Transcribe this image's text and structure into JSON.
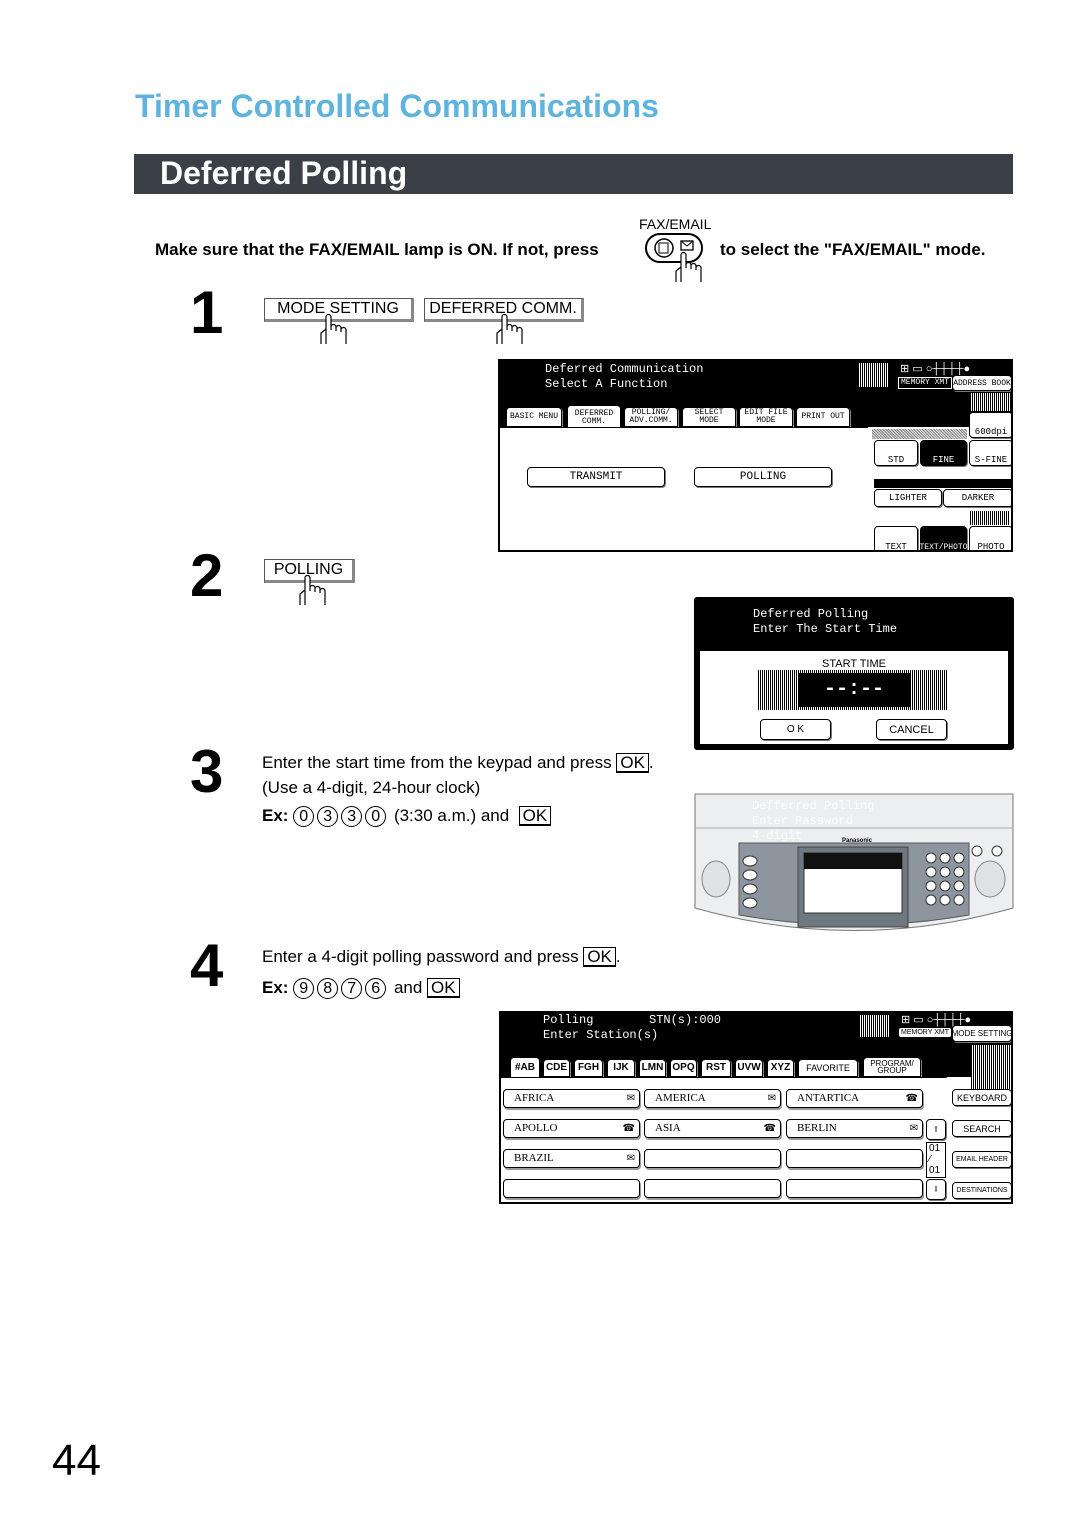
{
  "header": {
    "section_title": "Timer Controlled Communications",
    "page_title": "Deferred Polling"
  },
  "intro": {
    "text_before": "Make sure that the FAX/EMAIL lamp is ON.  If not, press",
    "button_label": "FAX/EMAIL",
    "text_after": "to select the \"FAX/EMAIL\" mode."
  },
  "steps": [
    {
      "number": "1",
      "buttons": [
        "MODE SETTING",
        "DEFERRED COMM."
      ]
    },
    {
      "number": "2",
      "buttons": [
        "POLLING"
      ]
    },
    {
      "number": "3",
      "line1": "Enter the start time from the keypad and press",
      "ok": "OK",
      "period": ".",
      "line2": "(Use a 4-digit, 24-hour clock)",
      "ex_label": "Ex:",
      "ex_digits": [
        "0",
        "3",
        "3",
        "0"
      ],
      "ex_note": "(3:30 a.m.) and",
      "ex_ok": "OK"
    },
    {
      "number": "4",
      "line1": "Enter a 4-digit polling password and press",
      "ok": "OK",
      "period": ".",
      "ex_label": "Ex:",
      "ex_digits": [
        "9",
        "8",
        "7",
        "6"
      ],
      "ex_and": "and",
      "ex_ok": "OK"
    }
  ],
  "screen1": {
    "line1": "Deferred Communication",
    "line2": "Select A Function",
    "tabs": [
      "BASIC MENU",
      "DEFERRED COMM.",
      "POLLING/ ADV.COMM.",
      "SELECT MODE",
      "EDIT FILE MODE",
      "PRINT OUT"
    ],
    "active_tab": "DEFERRED COMM.",
    "buttons": [
      "TRANSMIT",
      "POLLING"
    ],
    "memory_xmt": "MEMORY XMT",
    "address_book": "ADDRESS BOOK",
    "resolution_600": "600dpi",
    "resolutions": [
      "STD",
      "FINE",
      "S-FINE"
    ],
    "active_resolution": "FINE",
    "contrast": [
      "LIGHTER",
      "DARKER"
    ],
    "contrast_level": 4,
    "contrast_steps": 7,
    "originals": [
      "TEXT",
      "TEXT/PHOTO",
      "PHOTO"
    ],
    "active_original": "TEXT/PHOTO"
  },
  "screen2": {
    "line1": "Deferred Polling",
    "line2": "Enter The Start Time",
    "field_label": "START TIME",
    "value": "--:--",
    "ok": "O K",
    "cancel": "CANCEL"
  },
  "panel_overlay": {
    "line1": "Defferred Polling",
    "line2": "Enter Password",
    "line3": "4-digit",
    "brand": "Panasonic"
  },
  "screen3": {
    "line1": "Polling",
    "stations": "STN(s):000",
    "line2": "Enter Station(s)",
    "memory_xmt": "MEMORY XMT",
    "mode_setting": "MODE SETTING",
    "tabs": [
      "#AB",
      "CDE",
      "FGH",
      "IJK",
      "LMN",
      "OPQ",
      "RST",
      "UVW",
      "XYZ",
      "FAVORITE",
      "PROGRAM/ GROUP"
    ],
    "active_tab": "#AB",
    "entries": [
      {
        "name": "AFRICA",
        "icon": "email-icon"
      },
      {
        "name": "AMERICA",
        "icon": "email-icon"
      },
      {
        "name": "ANTARTICA",
        "icon": "phone-icon"
      },
      {
        "name": "APOLLO",
        "icon": "phone-icon"
      },
      {
        "name": "ASIA",
        "icon": "phone-icon"
      },
      {
        "name": "BERLIN",
        "icon": "email-icon"
      },
      {
        "name": "BRAZIL",
        "icon": "email-icon"
      },
      {
        "name": "",
        "icon": ""
      },
      {
        "name": "",
        "icon": ""
      },
      {
        "name": "",
        "icon": ""
      },
      {
        "name": "",
        "icon": ""
      },
      {
        "name": "",
        "icon": ""
      }
    ],
    "page_current": "01",
    "page_total": "01",
    "side_buttons": [
      "KEYBOARD",
      "SEARCH",
      "EMAIL HEADER",
      "DESTINATIONS"
    ]
  },
  "footer": {
    "page_number": "44"
  }
}
